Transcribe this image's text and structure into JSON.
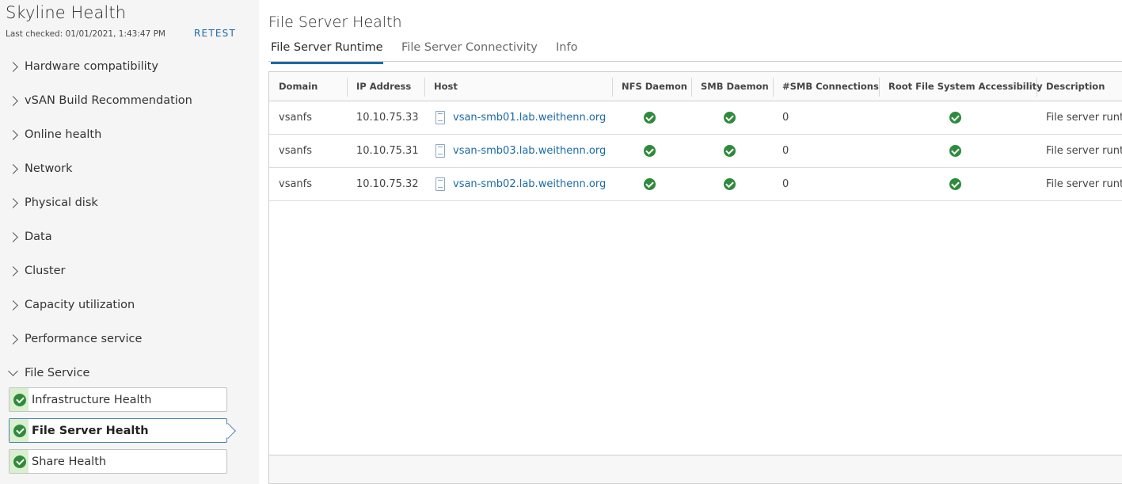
{
  "sidebar": {
    "title": "Skyline Health",
    "last_checked": "Last checked: 01/01/2021, 1:43:47 PM",
    "retest_label": "RETEST",
    "categories": [
      "Hardware compatibility",
      "vSAN Build Recommendation",
      "Online health",
      "Network",
      "Physical disk",
      "Data",
      "Cluster",
      "Capacity utilization",
      "Performance service",
      "File Service"
    ],
    "file_service_items": [
      {
        "label": "Infrastructure Health",
        "status": "ok"
      },
      {
        "label": "File Server Health",
        "status": "ok",
        "selected": true
      },
      {
        "label": "Share Health",
        "status": "ok"
      }
    ]
  },
  "main": {
    "title": "File Server Health",
    "tabs": [
      "File Server Runtime",
      "File Server Connectivity",
      "Info"
    ],
    "active_tab": "File Server Runtime",
    "table": {
      "columns": [
        "Domain",
        "IP Address",
        "Host",
        "NFS Daemon",
        "SMB Daemon",
        "#SMB Connections",
        "Root File System Accessibility",
        "Description"
      ],
      "rows": [
        {
          "domain": "vsanfs",
          "ip": "10.10.75.33",
          "host": "vsan-smb01.lab.weithenn.org",
          "nfs": "ok",
          "smb": "ok",
          "smb_conn": "0",
          "root_fs": "ok",
          "description": "File server runt"
        },
        {
          "domain": "vsanfs",
          "ip": "10.10.75.31",
          "host": "vsan-smb03.lab.weithenn.org",
          "nfs": "ok",
          "smb": "ok",
          "smb_conn": "0",
          "root_fs": "ok",
          "description": "File server runt"
        },
        {
          "domain": "vsanfs",
          "ip": "10.10.75.32",
          "host": "vsan-smb02.lab.weithenn.org",
          "nfs": "ok",
          "smb": "ok",
          "smb_conn": "0",
          "root_fs": "ok",
          "description": "File server runt"
        }
      ]
    }
  },
  "colors": {
    "accent": "#1a6aa7",
    "success": "#2f8a3b",
    "sidebar_bg": "#f5f5f5"
  },
  "icons": {
    "expand": "chevron-right-icon",
    "collapse": "chevron-down-icon",
    "status_ok": "check-circle-icon",
    "host": "server-icon"
  }
}
